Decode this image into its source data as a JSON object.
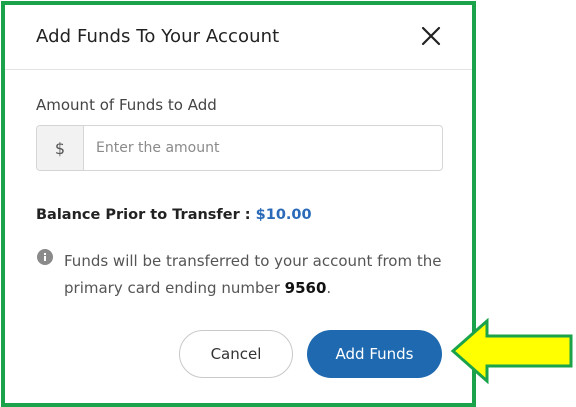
{
  "dialog": {
    "title": "Add Funds To Your Account",
    "amount_label": "Amount of Funds to Add",
    "currency_symbol": "$",
    "amount_placeholder": "Enter the amount",
    "amount_value": "",
    "balance_label": "Balance Prior to Transfer :",
    "balance_value": "$10.00",
    "info_text_prefix": "Funds will be transferred to your account from the primary card ending number",
    "card_last4": "9560",
    "info_text_suffix": ".",
    "cancel_label": "Cancel",
    "add_label": "Add Funds"
  },
  "icons": {
    "close": "close-icon",
    "info": "info-icon",
    "annotation": "arrow-left-icon"
  },
  "colors": {
    "frame_border": "#1aa34a",
    "primary_button": "#1f69b0",
    "balance_value": "#2a6ab8",
    "annotation_arrow_fill": "#ffff00",
    "annotation_arrow_stroke": "#1aa34a"
  }
}
